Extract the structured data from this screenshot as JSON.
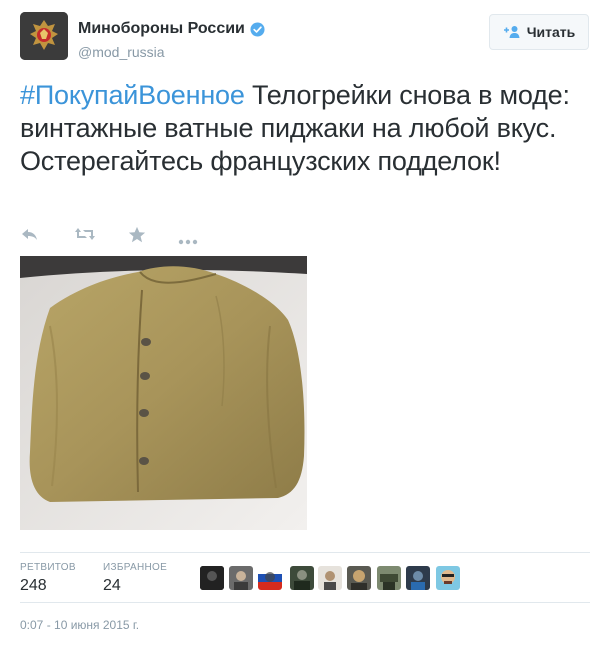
{
  "account": {
    "name": "Минобороны России",
    "handle": "@mod_russia"
  },
  "follow_button": {
    "label": "Читать"
  },
  "tweet": {
    "hashtag": "#ПокупайВоенное",
    "text": " Телогрейки снова в моде: винтажные ватные пиджаки на любой вкус. Остерегайтесь французских подделок!"
  },
  "actions": [
    "reply-icon",
    "retweet-icon",
    "favorite-icon",
    "more-icon"
  ],
  "stats": {
    "retweets": {
      "label": "РЕТВИТОВ",
      "value": "248"
    },
    "favorites": {
      "label": "ИЗБРАННОЕ",
      "value": "24"
    }
  },
  "favorited_by_avatars_count": 9,
  "timestamp": "0:07 - 10 июня 2015 г.",
  "colors": {
    "text": "#292f33",
    "muted": "#8899a6",
    "link": "#3b94d9",
    "verified": "#55acee",
    "border": "#e1e8ed"
  }
}
